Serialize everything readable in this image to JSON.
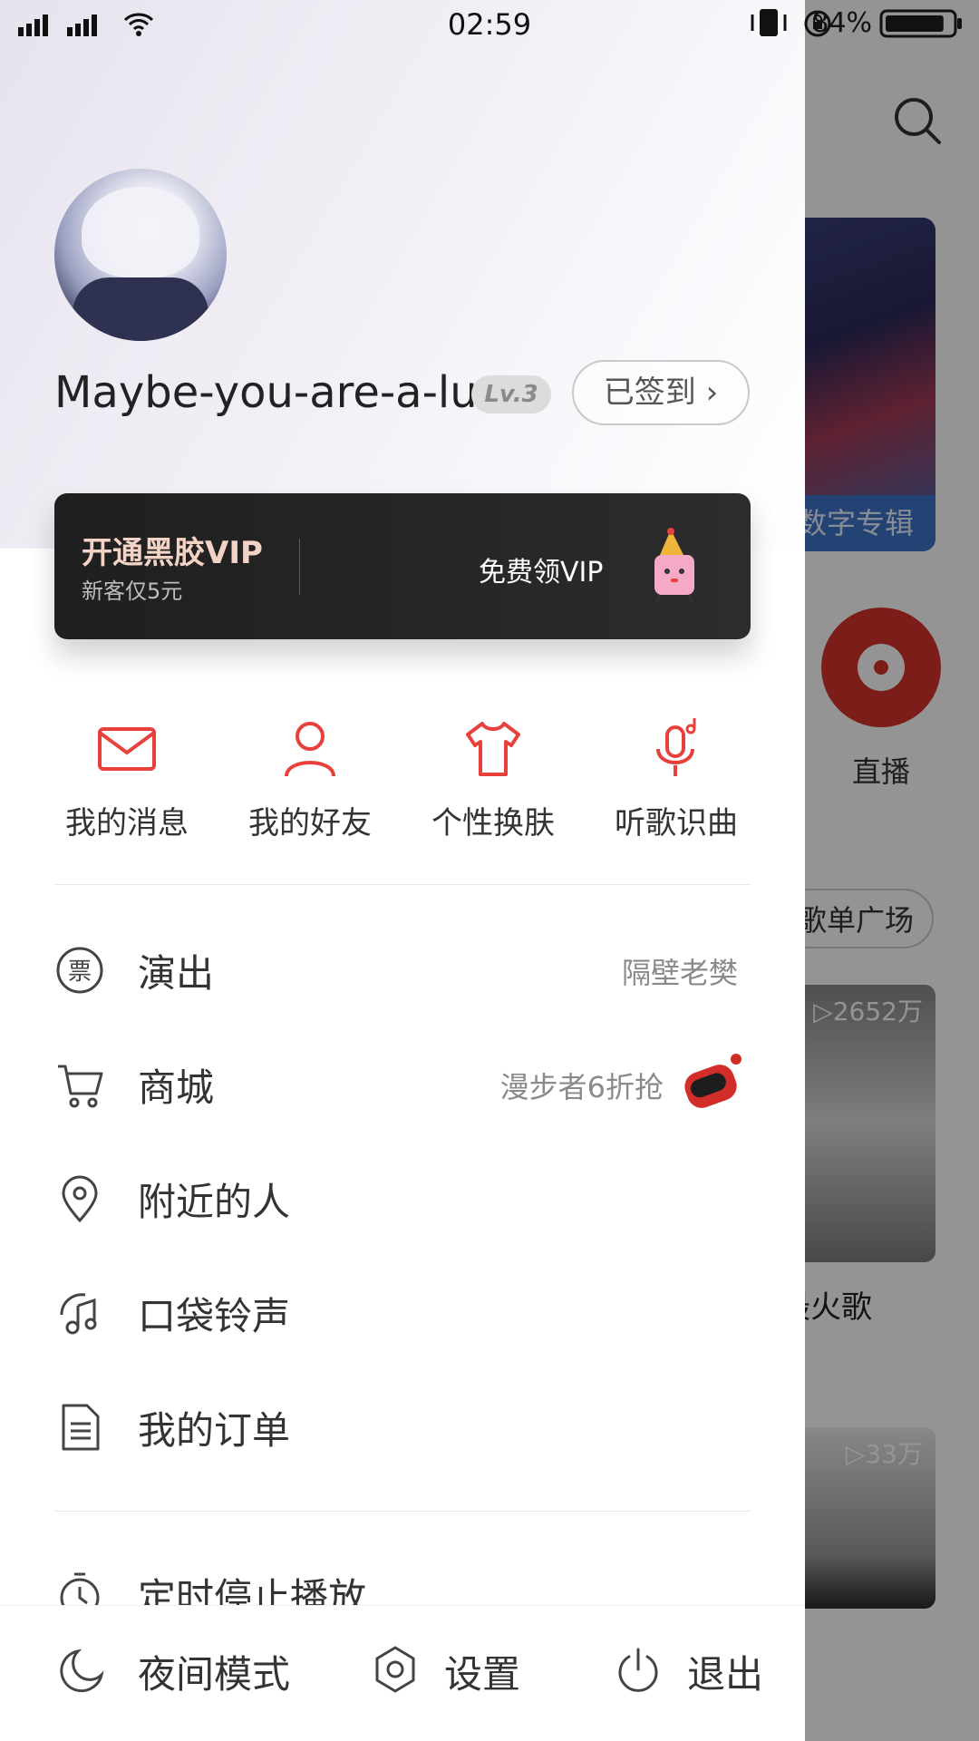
{
  "status_bar": {
    "time": "02:59",
    "battery": "84%",
    "battery_level": 0.84
  },
  "profile": {
    "username": "Maybe-you-are-a-lu...",
    "level": "Lv.3",
    "signin": "已签到",
    "signin_chevron": "›"
  },
  "vip": {
    "title": "开通黑胶VIP",
    "subtitle": "新客仅5元",
    "free_label": "免费领VIP"
  },
  "quick_actions": [
    {
      "label": "我的消息",
      "icon": "mail-icon"
    },
    {
      "label": "我的好友",
      "icon": "person-icon"
    },
    {
      "label": "个性换肤",
      "icon": "tshirt-icon"
    },
    {
      "label": "听歌识曲",
      "icon": "mic-music-icon"
    }
  ],
  "menu": [
    {
      "label": "演出",
      "icon": "ticket-icon",
      "right": "隔壁老樊"
    },
    {
      "label": "商城",
      "icon": "cart-icon",
      "right": "漫步者6折抢"
    },
    {
      "label": "附近的人",
      "icon": "location-pin-icon",
      "right": ""
    },
    {
      "label": "口袋铃声",
      "icon": "ringtone-icon",
      "right": ""
    },
    {
      "label": "我的订单",
      "icon": "document-icon",
      "right": ""
    },
    {
      "label": "定时停止播放",
      "icon": "timer-icon",
      "right": ""
    }
  ],
  "bottom_bar": {
    "night": "夜间模式",
    "settings": "设置",
    "logout": "退出"
  },
  "background": {
    "banner_label": "数字专辑",
    "live_label": "直播",
    "pill_label": "歌单广场",
    "card1_count": "▷2652万",
    "card1_title": "最火歌",
    "card2_count": "▷33万"
  },
  "colors": {
    "accent": "#e8413b",
    "vip_bg": "#242424",
    "vip_title": "#f2d3c6"
  }
}
